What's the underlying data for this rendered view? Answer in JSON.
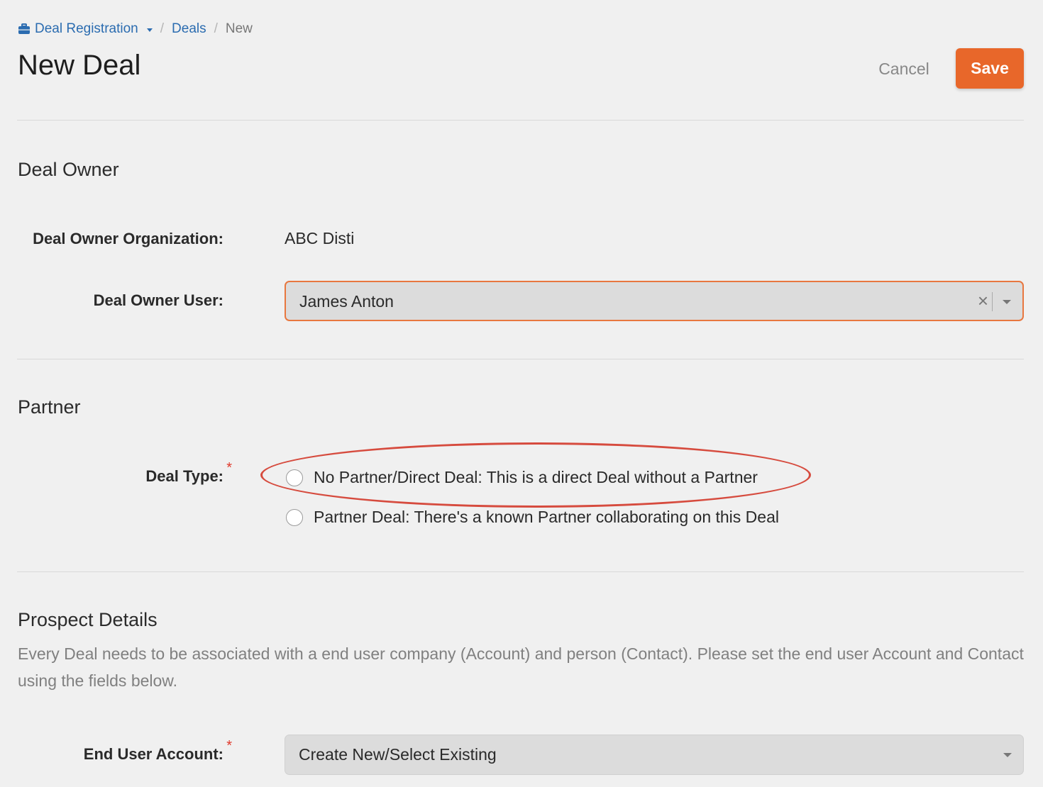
{
  "breadcrumb": {
    "home_label": "Deal Registration",
    "deals_label": "Deals",
    "current_label": "New",
    "separator": "/"
  },
  "header": {
    "title": "New Deal",
    "cancel_label": "Cancel",
    "save_label": "Save"
  },
  "deal_owner": {
    "section_title": "Deal Owner",
    "org_label": "Deal Owner Organization:",
    "org_value": "ABC Disti",
    "user_label": "Deal Owner User:",
    "user_value": "James Anton",
    "clear_glyph": "×"
  },
  "partner": {
    "section_title": "Partner",
    "deal_type_label": "Deal Type:",
    "required_mark": "*",
    "options": [
      {
        "label": "No Partner/Direct Deal: This is a direct Deal without a Partner"
      },
      {
        "label": "Partner Deal: There's a known Partner collaborating on this Deal"
      }
    ]
  },
  "prospect": {
    "section_title": "Prospect Details",
    "description": "Every Deal needs to be associated with a end user company (Account) and person (Contact). Please set the end user Account and Contact using the fields below.",
    "account_label": "End User Account:",
    "required_mark": "*",
    "account_placeholder": "Create New/Select Existing"
  },
  "colors": {
    "accent": "#e8672a",
    "link": "#2b6cb0",
    "required": "#e0392b",
    "annotation": "#d64b3e"
  },
  "icons": {
    "home": "briefcase-icon",
    "dropdown": "chevron-down-icon",
    "clear": "close-icon"
  }
}
